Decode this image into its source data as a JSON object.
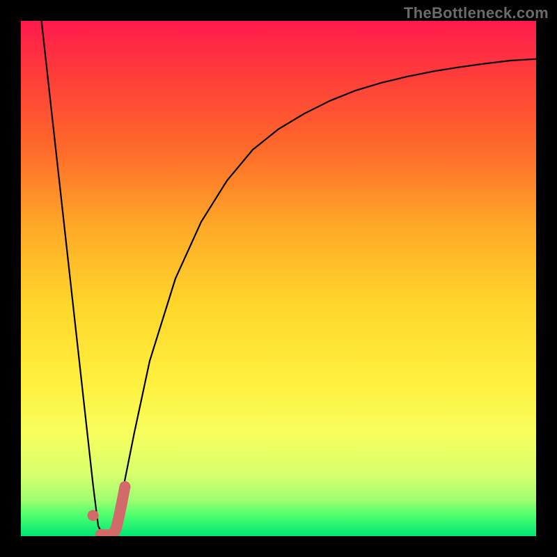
{
  "watermark": {
    "text": "TheBottleneck.com"
  },
  "chart_data": {
    "type": "line",
    "title": "",
    "xlabel": "",
    "ylabel": "",
    "xlim": [
      0,
      100
    ],
    "ylim": [
      0,
      100
    ],
    "grid": false,
    "legend": false,
    "series": [
      {
        "name": "bottleneck-curve",
        "color": "#000000",
        "x": [
          4,
          6,
          8,
          10,
          12,
          14,
          15,
          16,
          17,
          18,
          20,
          22,
          25,
          30,
          35,
          40,
          45,
          50,
          55,
          60,
          65,
          70,
          75,
          80,
          85,
          90,
          95,
          100
        ],
        "values": [
          100,
          82,
          64,
          46,
          28,
          10,
          2,
          0,
          0,
          2,
          10,
          20,
          34,
          50,
          61,
          69,
          75,
          79,
          82,
          84.5,
          86.5,
          88,
          89.2,
          90.2,
          91,
          91.7,
          92.3,
          92.6
        ]
      },
      {
        "name": "current-config",
        "color": "#d36a6a",
        "type": "marker",
        "x": [
          14
        ],
        "values": [
          4
        ]
      },
      {
        "name": "recommended-sweep",
        "color": "#d36a6a",
        "type": "thick-line",
        "x": [
          15.5,
          16.5,
          17.5,
          18,
          18.5,
          19,
          19.6,
          20.2
        ],
        "values": [
          0.3,
          0.2,
          0.3,
          0.6,
          1.5,
          3.6,
          6.5,
          9.6
        ]
      }
    ],
    "annotations": []
  }
}
